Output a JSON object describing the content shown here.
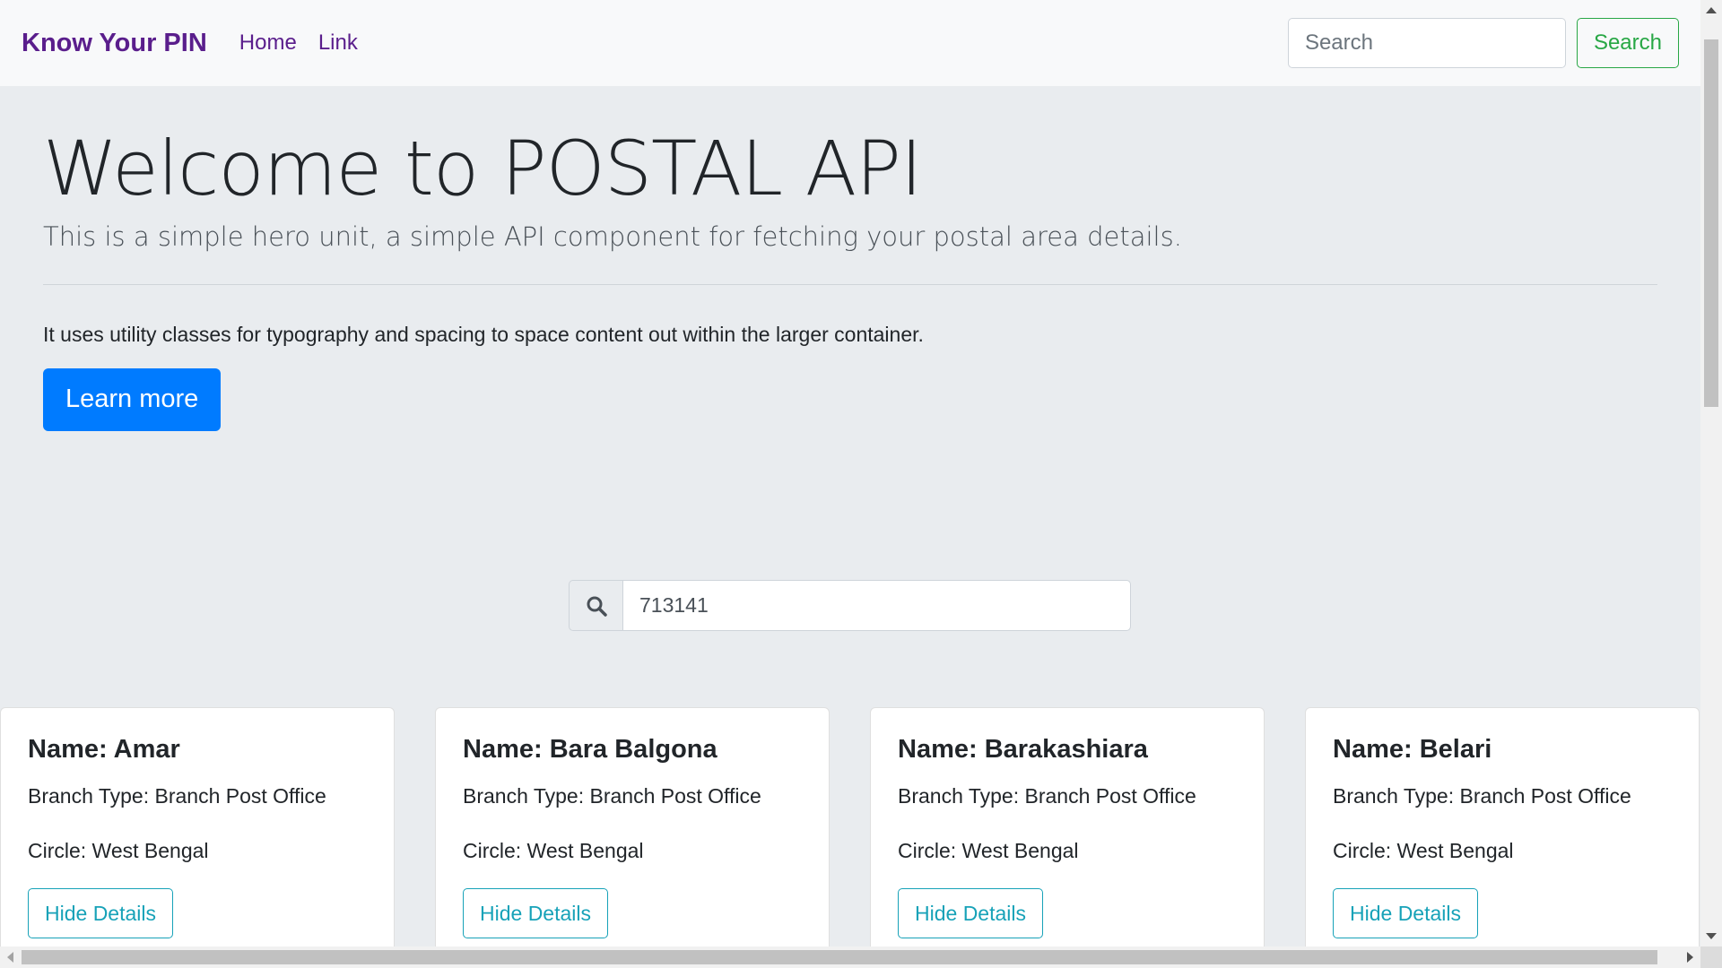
{
  "navbar": {
    "brand": "Know Your PIN",
    "links": [
      "Home",
      "Link"
    ],
    "search_placeholder": "Search",
    "search_button": "Search"
  },
  "jumbotron": {
    "title": "Welcome to POSTAL API",
    "lead": "This is a simple hero unit, a simple API component for fetching your postal area details.",
    "text": "It uses utility classes for typography and spacing to space content out within the larger container.",
    "button": "Learn more"
  },
  "pin_search": {
    "icon": "search-icon",
    "value": "713141"
  },
  "cards": [
    {
      "name": "Name: Amar",
      "branch_type": "Branch Type: Branch Post Office",
      "circle": "Circle: West Bengal",
      "button": "Hide Details"
    },
    {
      "name": "Name: Bara Balgona",
      "branch_type": "Branch Type: Branch Post Office",
      "circle": "Circle: West Bengal",
      "button": "Hide Details"
    },
    {
      "name": "Name: Barakashiara",
      "branch_type": "Branch Type: Branch Post Office",
      "circle": "Circle: West Bengal",
      "button": "Hide Details"
    },
    {
      "name": "Name: Belari",
      "branch_type": "Branch Type: Branch Post Office",
      "circle": "Circle: West Bengal",
      "button": "Hide Details"
    }
  ],
  "colors": {
    "brand": "#5a1e8c",
    "primary": "#007bff",
    "success": "#28a745",
    "info": "#17a2b8",
    "jumbotron_bg": "#e9ecef"
  }
}
